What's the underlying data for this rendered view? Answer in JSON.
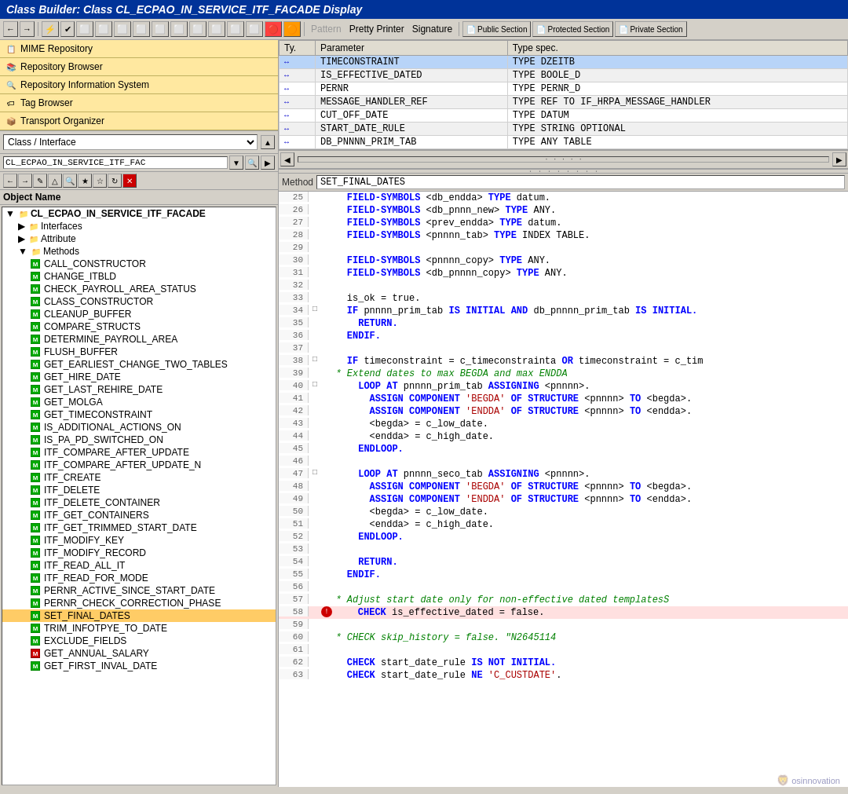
{
  "title": "Class Builder: Class CL_ECPAO_IN_SERVICE_ITF_FACADE Display",
  "toolbar": {
    "buttons": [
      "←",
      "→",
      "⬡",
      "⬡",
      "⬡",
      "⬡",
      "⬡",
      "⬡",
      "⬡",
      "⬡",
      "⬡",
      "⬡",
      "⬡",
      "⬡",
      "⬡",
      "⬡",
      "⬡",
      "⬡",
      "⬡",
      "⬡"
    ],
    "pattern_label": "Pattern",
    "pretty_printer_label": "Pretty Printer",
    "signature_label": "Signature",
    "public_section_label": "Public Section",
    "protected_section_label": "Protected Section",
    "private_section_label": "Private Section"
  },
  "left_panel": {
    "nav_items": [
      {
        "icon": "📋",
        "label": "MIME Repository"
      },
      {
        "icon": "📚",
        "label": "Repository Browser"
      },
      {
        "icon": "🔍",
        "label": "Repository Information System"
      },
      {
        "icon": "🏷",
        "label": "Tag Browser"
      },
      {
        "icon": "📦",
        "label": "Transport Organizer"
      }
    ],
    "class_interface_label": "Class / Interface",
    "class_name": "CL_ECPAO_IN_SERVICE_ITF_FAC",
    "object_name_header": "Object Name",
    "tree": {
      "root": "CL_ECPAO_IN_SERVICE_ITF_FACADE",
      "nodes": [
        {
          "indent": 1,
          "type": "folder",
          "label": "Interfaces"
        },
        {
          "indent": 1,
          "type": "folder",
          "label": "Attribute"
        },
        {
          "indent": 1,
          "type": "folder",
          "label": "Methods",
          "expanded": true
        },
        {
          "indent": 2,
          "type": "method_green",
          "label": "CALL_CONSTRUCTOR"
        },
        {
          "indent": 2,
          "type": "method_green",
          "label": "CHANGE_ITBLD"
        },
        {
          "indent": 2,
          "type": "method_green",
          "label": "CHECK_PAYROLL_AREA_STATUS"
        },
        {
          "indent": 2,
          "type": "method_green",
          "label": "CLASS_CONSTRUCTOR"
        },
        {
          "indent": 2,
          "type": "method_green",
          "label": "CLEANUP_BUFFER"
        },
        {
          "indent": 2,
          "type": "method_green",
          "label": "COMPARE_STRUCTS"
        },
        {
          "indent": 2,
          "type": "method_green",
          "label": "DETERMINE_PAYROLL_AREA"
        },
        {
          "indent": 2,
          "type": "method_green",
          "label": "FLUSH_BUFFER"
        },
        {
          "indent": 2,
          "type": "method_green",
          "label": "GET_EARLIEST_CHANGE_TWO_TABLES"
        },
        {
          "indent": 2,
          "type": "method_green",
          "label": "GET_HIRE_DATE"
        },
        {
          "indent": 2,
          "type": "method_green",
          "label": "GET_LAST_REHIRE_DATE"
        },
        {
          "indent": 2,
          "type": "method_green",
          "label": "GET_MOLGA"
        },
        {
          "indent": 2,
          "type": "method_green",
          "label": "GET_TIMECONSTRAINT"
        },
        {
          "indent": 2,
          "type": "method_green",
          "label": "IS_ADDITIONAL_ACTIONS_ON"
        },
        {
          "indent": 2,
          "type": "method_green",
          "label": "IS_PA_PD_SWITCHED_ON"
        },
        {
          "indent": 2,
          "type": "method_green",
          "label": "ITF_COMPARE_AFTER_UPDATE"
        },
        {
          "indent": 2,
          "type": "method_green",
          "label": "ITF_COMPARE_AFTER_UPDATE_N"
        },
        {
          "indent": 2,
          "type": "method_green",
          "label": "ITF_CREATE"
        },
        {
          "indent": 2,
          "type": "method_green",
          "label": "ITF_DELETE"
        },
        {
          "indent": 2,
          "type": "method_green",
          "label": "ITF_DELETE_CONTAINER"
        },
        {
          "indent": 2,
          "type": "method_green",
          "label": "ITF_GET_CONTAINERS"
        },
        {
          "indent": 2,
          "type": "method_green",
          "label": "ITF_GET_TRIMMED_START_DATE"
        },
        {
          "indent": 2,
          "type": "method_green",
          "label": "ITF_MODIFY_KEY"
        },
        {
          "indent": 2,
          "type": "method_green",
          "label": "ITF_MODIFY_RECORD"
        },
        {
          "indent": 2,
          "type": "method_green",
          "label": "ITF_READ_ALL_IT"
        },
        {
          "indent": 2,
          "type": "method_green",
          "label": "ITF_READ_FOR_MODE"
        },
        {
          "indent": 2,
          "type": "method_green",
          "label": "PERNR_ACTIVE_SINCE_START_DATE"
        },
        {
          "indent": 2,
          "type": "method_green",
          "label": "PERNR_CHECK_CORRECTION_PHASE"
        },
        {
          "indent": 2,
          "type": "method_selected",
          "label": "SET_FINAL_DATES"
        },
        {
          "indent": 2,
          "type": "method_green",
          "label": "TRIM_INFOTPYE_TO_DATE"
        },
        {
          "indent": 2,
          "type": "method_green",
          "label": "EXCLUDE_FIELDS"
        },
        {
          "indent": 2,
          "type": "method_red",
          "label": "GET_ANNUAL_SALARY"
        },
        {
          "indent": 2,
          "type": "method_green",
          "label": "GET_FIRST_INVAL_DATE"
        }
      ]
    }
  },
  "right_panel": {
    "params_columns": [
      "Ty.",
      "Parameter",
      "Type spec."
    ],
    "params_rows": [
      {
        "type": "↔",
        "parameter": "TIMECONSTRAINT",
        "typespec": "TYPE DZEITB",
        "selected": true
      },
      {
        "type": "↔",
        "parameter": "IS_EFFECTIVE_DATED",
        "typespec": "TYPE BOOLE_D"
      },
      {
        "type": "↔",
        "parameter": "PERNR",
        "typespec": "TYPE PERNR_D"
      },
      {
        "type": "↔",
        "parameter": "MESSAGE_HANDLER_REF",
        "typespec": "TYPE REF TO IF_HRPA_MESSAGE_HANDLER"
      },
      {
        "type": "↔",
        "parameter": "CUT_OFF_DATE",
        "typespec": "TYPE DATUM"
      },
      {
        "type": "↔",
        "parameter": "START_DATE_RULE",
        "typespec": "TYPE STRING OPTIONAL"
      },
      {
        "type": "↔",
        "parameter": "DB_PNNNN_PRIM_TAB",
        "typespec": "TYPE ANY TABLE"
      }
    ],
    "method_label": "Method",
    "method_name": "SET_FINAL_DATES",
    "code_lines": [
      {
        "num": 25,
        "expand": null,
        "content": "    FIELD-SYMBOLS <db_endda> TYPE datum.",
        "tokens": [
          {
            "t": "kw",
            "v": "    FIELD-SYMBOLS"
          },
          {
            "t": "var",
            "v": " <db_endda> "
          },
          {
            "t": "kw",
            "v": "TYPE"
          },
          {
            "t": "var",
            "v": " datum."
          }
        ]
      },
      {
        "num": 26,
        "expand": null,
        "content": "    FIELD-SYMBOLS <db_pnnn_new> TYPE ANY.",
        "tokens": [
          {
            "t": "kw",
            "v": "    FIELD-SYMBOLS"
          },
          {
            "t": "var",
            "v": " <db_pnnn_new> "
          },
          {
            "t": "kw",
            "v": "TYPE"
          },
          {
            "t": "var",
            "v": " ANY."
          }
        ]
      },
      {
        "num": 27,
        "expand": null,
        "content": "    FIELD-SYMBOLS <prev_endda> TYPE datum.",
        "tokens": [
          {
            "t": "kw",
            "v": "    FIELD-SYMBOLS"
          },
          {
            "t": "var",
            "v": " <prev_endda> "
          },
          {
            "t": "kw",
            "v": "TYPE"
          },
          {
            "t": "var",
            "v": " datum."
          }
        ]
      },
      {
        "num": 28,
        "expand": null,
        "content": "    FIELD-SYMBOLS <pnnnn_tab> TYPE INDEX TABLE.",
        "tokens": [
          {
            "t": "kw",
            "v": "    FIELD-SYMBOLS"
          },
          {
            "t": "var",
            "v": " <pnnnn_tab> "
          },
          {
            "t": "kw",
            "v": "TYPE"
          },
          {
            "t": "var",
            "v": " INDEX TABLE."
          }
        ]
      },
      {
        "num": 29,
        "expand": null,
        "content": ""
      },
      {
        "num": 30,
        "expand": null,
        "content": "    FIELD-SYMBOLS <pnnnn_copy> TYPE ANY.",
        "tokens": [
          {
            "t": "kw",
            "v": "    FIELD-SYMBOLS"
          },
          {
            "t": "var",
            "v": " <pnnnn_copy> "
          },
          {
            "t": "kw",
            "v": "TYPE"
          },
          {
            "t": "var",
            "v": " ANY."
          }
        ]
      },
      {
        "num": 31,
        "expand": null,
        "content": "    FIELD-SYMBOLS <db_pnnnn_copy> TYPE ANY.",
        "tokens": [
          {
            "t": "kw",
            "v": "    FIELD-SYMBOLS"
          },
          {
            "t": "var",
            "v": " <db_pnnnn_copy> "
          },
          {
            "t": "kw",
            "v": "TYPE"
          },
          {
            "t": "var",
            "v": " ANY."
          }
        ]
      },
      {
        "num": 32,
        "expand": null,
        "content": ""
      },
      {
        "num": 33,
        "expand": null,
        "content": "    is_ok = true.",
        "tokens": [
          {
            "t": "var",
            "v": "    is_ok = true."
          }
        ]
      },
      {
        "num": 34,
        "expand": "□",
        "content": "    IF pnnnn_prim_tab IS INITIAL AND db_pnnnn_prim_tab IS INITIAL.",
        "tokens": [
          {
            "t": "kw",
            "v": "    IF"
          },
          {
            "t": "var",
            "v": " pnnnn_prim_tab "
          },
          {
            "t": "kw",
            "v": "IS INITIAL AND"
          },
          {
            "t": "var",
            "v": " db_pnnnn_prim_tab "
          },
          {
            "t": "kw",
            "v": "IS INITIAL."
          }
        ]
      },
      {
        "num": 35,
        "expand": null,
        "content": "      RETURN.",
        "tokens": [
          {
            "t": "kw",
            "v": "      RETURN."
          }
        ]
      },
      {
        "num": 36,
        "expand": null,
        "content": "    ENDIF.",
        "tokens": [
          {
            "t": "kw",
            "v": "    ENDIF."
          }
        ]
      },
      {
        "num": 37,
        "expand": null,
        "content": ""
      },
      {
        "num": 38,
        "expand": "□",
        "content": "    IF timeconstraint = c_timeconstrainta OR timeconstraint = c_tim",
        "tokens": [
          {
            "t": "kw",
            "v": "    IF"
          },
          {
            "t": "var",
            "v": " timeconstraint = c_timeconstrainta "
          },
          {
            "t": "kw",
            "v": "OR"
          },
          {
            "t": "var",
            "v": " timeconstraint = c_tim"
          }
        ]
      },
      {
        "num": 39,
        "expand": null,
        "content": "  * Extend dates to max BEGDA and max ENDDA",
        "tokens": [
          {
            "t": "comment",
            "v": "  * Extend dates to max BEGDA and max ENDDA"
          }
        ]
      },
      {
        "num": 40,
        "expand": "□",
        "content": "      LOOP AT pnnnn_prim_tab ASSIGNING <pnnnn>.",
        "tokens": [
          {
            "t": "kw",
            "v": "      LOOP AT"
          },
          {
            "t": "var",
            "v": " pnnnn_prim_tab "
          },
          {
            "t": "kw",
            "v": "ASSIGNING"
          },
          {
            "t": "var",
            "v": " <pnnnn>."
          }
        ]
      },
      {
        "num": 41,
        "expand": null,
        "content": "        ASSIGN COMPONENT 'BEGDA' OF STRUCTURE <pnnnn> TO <begda>.",
        "tokens": [
          {
            "t": "kw",
            "v": "        ASSIGN COMPONENT"
          },
          {
            "t": "str",
            "v": " 'BEGDA'"
          },
          {
            "t": "kw",
            "v": " OF STRUCTURE"
          },
          {
            "t": "var",
            "v": " <pnnnn> "
          },
          {
            "t": "kw",
            "v": "TO"
          },
          {
            "t": "var",
            "v": " <begda>."
          }
        ]
      },
      {
        "num": 42,
        "expand": null,
        "content": "        ASSIGN COMPONENT 'ENDDA' OF STRUCTURE <pnnnn> TO <endda>.",
        "tokens": [
          {
            "t": "kw",
            "v": "        ASSIGN COMPONENT"
          },
          {
            "t": "str",
            "v": " 'ENDDA'"
          },
          {
            "t": "kw",
            "v": " OF STRUCTURE"
          },
          {
            "t": "var",
            "v": " <pnnnn> "
          },
          {
            "t": "kw",
            "v": "TO"
          },
          {
            "t": "var",
            "v": " <endda>."
          }
        ]
      },
      {
        "num": 43,
        "expand": null,
        "content": "        <begda> = c_low_date.",
        "tokens": [
          {
            "t": "var",
            "v": "        <begda> = c_low_date."
          }
        ]
      },
      {
        "num": 44,
        "expand": null,
        "content": "        <endda> = c_high_date.",
        "tokens": [
          {
            "t": "var",
            "v": "        <endda> = c_high_date."
          }
        ]
      },
      {
        "num": 45,
        "expand": null,
        "content": "      ENDLOOP.",
        "tokens": [
          {
            "t": "kw",
            "v": "      ENDLOOP."
          }
        ]
      },
      {
        "num": 46,
        "expand": null,
        "content": ""
      },
      {
        "num": 47,
        "expand": "□",
        "content": "      LOOP AT pnnnn_seco_tab ASSIGNING <pnnnn>.",
        "tokens": [
          {
            "t": "kw",
            "v": "      LOOP AT"
          },
          {
            "t": "var",
            "v": " pnnnn_seco_tab "
          },
          {
            "t": "kw",
            "v": "ASSIGNING"
          },
          {
            "t": "var",
            "v": " <pnnnn>."
          }
        ]
      },
      {
        "num": 48,
        "expand": null,
        "content": "        ASSIGN COMPONENT 'BEGDA' OF STRUCTURE <pnnnn> TO <begda>.",
        "tokens": [
          {
            "t": "kw",
            "v": "        ASSIGN COMPONENT"
          },
          {
            "t": "str",
            "v": " 'BEGDA'"
          },
          {
            "t": "kw",
            "v": " OF STRUCTURE"
          },
          {
            "t": "var",
            "v": " <pnnnn> "
          },
          {
            "t": "kw",
            "v": "TO"
          },
          {
            "t": "var",
            "v": " <begda>."
          }
        ]
      },
      {
        "num": 49,
        "expand": null,
        "content": "        ASSIGN COMPONENT 'ENDDA' OF STRUCTURE <pnnnn> TO <endda>.",
        "tokens": [
          {
            "t": "kw",
            "v": "        ASSIGN COMPONENT"
          },
          {
            "t": "str",
            "v": " 'ENDDA'"
          },
          {
            "t": "kw",
            "v": " OF STRUCTURE"
          },
          {
            "t": "var",
            "v": " <pnnnn> "
          },
          {
            "t": "kw",
            "v": "TO"
          },
          {
            "t": "var",
            "v": " <endda>."
          }
        ]
      },
      {
        "num": 50,
        "expand": null,
        "content": "        <begda> = c_low_date.",
        "tokens": [
          {
            "t": "var",
            "v": "        <begda> = c_low_date."
          }
        ]
      },
      {
        "num": 51,
        "expand": null,
        "content": "        <endda> = c_high_date.",
        "tokens": [
          {
            "t": "var",
            "v": "        <endda> = c_high_date."
          }
        ]
      },
      {
        "num": 52,
        "expand": null,
        "content": "      ENDLOOP.",
        "tokens": [
          {
            "t": "kw",
            "v": "      ENDLOOP."
          }
        ]
      },
      {
        "num": 53,
        "expand": null,
        "content": ""
      },
      {
        "num": 54,
        "expand": null,
        "content": "      RETURN.",
        "tokens": [
          {
            "t": "kw",
            "v": "      RETURN."
          }
        ]
      },
      {
        "num": 55,
        "expand": null,
        "content": "    ENDIF.",
        "tokens": [
          {
            "t": "kw",
            "v": "    ENDIF."
          }
        ]
      },
      {
        "num": 56,
        "expand": null,
        "content": ""
      },
      {
        "num": 57,
        "expand": null,
        "content": "  * Adjust start date only for non-effective dated templatesS",
        "tokens": [
          {
            "t": "comment",
            "v": "  * Adjust start date only for non-effective dated templatesS"
          }
        ]
      },
      {
        "num": 58,
        "expand": null,
        "content": "    CHECK is_effective_dated = false.",
        "highlight": true,
        "tokens": [
          {
            "t": "kw",
            "v": "    CHECK"
          },
          {
            "t": "var",
            "v": " is_effective_dated = false."
          }
        ]
      },
      {
        "num": 59,
        "expand": null,
        "content": ""
      },
      {
        "num": 60,
        "expand": null,
        "content": "  * CHECK skip_history = false. \"N2645114",
        "tokens": [
          {
            "t": "comment",
            "v": "  * CHECK skip_history = false. \"N2645114"
          }
        ]
      },
      {
        "num": 61,
        "expand": null,
        "content": ""
      },
      {
        "num": 62,
        "expand": null,
        "content": "    CHECK start_date_rule IS NOT INITIAL.",
        "tokens": [
          {
            "t": "kw",
            "v": "    CHECK"
          },
          {
            "t": "var",
            "v": " start_date_rule "
          },
          {
            "t": "kw",
            "v": "IS NOT INITIAL."
          }
        ]
      },
      {
        "num": 63,
        "expand": null,
        "content": "    CHECK start_date_rule NE 'C_CUSTDATE'.",
        "tokens": [
          {
            "t": "kw",
            "v": "    CHECK"
          },
          {
            "t": "var",
            "v": " start_date_rule "
          },
          {
            "t": "kw",
            "v": "NE"
          },
          {
            "t": "str",
            "v": " 'C_CUSTDATE'"
          },
          {
            "t": "var",
            "v": "."
          }
        ]
      }
    ]
  },
  "watermark": "osinnovation"
}
